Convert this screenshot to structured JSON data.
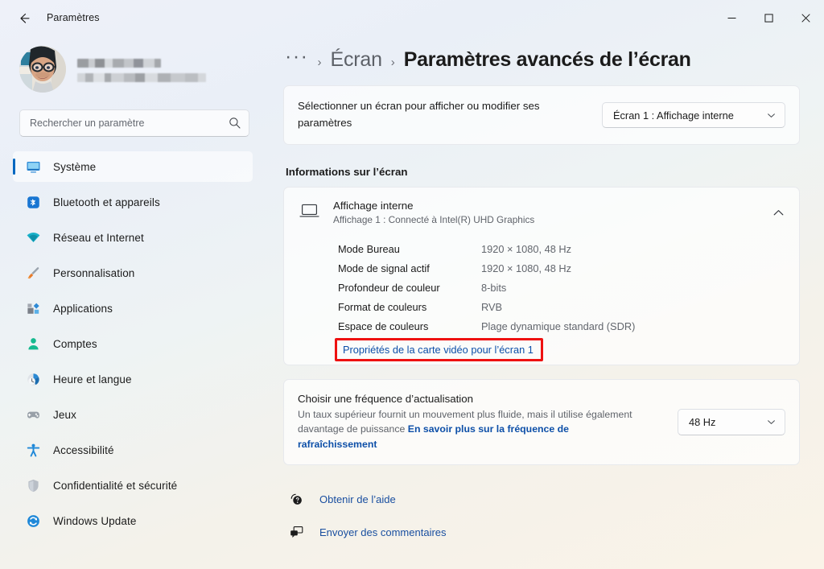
{
  "window": {
    "app_title": "Paramètres",
    "back_icon": "back-arrow-icon",
    "controls": {
      "minimize": "minimize-icon",
      "maximize": "maximize-icon",
      "close": "close-icon"
    }
  },
  "sidebar": {
    "profile": {
      "avatar": "user-avatar",
      "name_redacted": true,
      "email_redacted": true
    },
    "search": {
      "placeholder": "Rechercher un paramètre",
      "value": "",
      "icon": "search-icon"
    },
    "items": [
      {
        "label": "Système",
        "icon": "system-monitor-icon",
        "selected": true
      },
      {
        "label": "Bluetooth et appareils",
        "icon": "bluetooth-icon",
        "selected": false
      },
      {
        "label": "Réseau et Internet",
        "icon": "wifi-icon",
        "selected": false
      },
      {
        "label": "Personnalisation",
        "icon": "paintbrush-icon",
        "selected": false
      },
      {
        "label": "Applications",
        "icon": "apps-icon",
        "selected": false
      },
      {
        "label": "Comptes",
        "icon": "account-person-icon",
        "selected": false
      },
      {
        "label": "Heure et langue",
        "icon": "clock-icon",
        "selected": false
      },
      {
        "label": "Jeux",
        "icon": "gamepad-icon",
        "selected": false
      },
      {
        "label": "Accessibilité",
        "icon": "accessibility-person-icon",
        "selected": false
      },
      {
        "label": "Confidentialité et sécurité",
        "icon": "shield-icon",
        "selected": false
      },
      {
        "label": "Windows Update",
        "icon": "update-refresh-icon",
        "selected": false
      }
    ]
  },
  "breadcrumb": {
    "overflow": "···",
    "separator": "›",
    "parent": "Écran",
    "current": "Paramètres avancés de l’écran"
  },
  "select_display": {
    "description": "Sélectionner un écran pour afficher ou modifier ses paramètres",
    "dropdown_value": "Écran 1 : Affichage interne",
    "chevron_icon": "chevron-down-icon"
  },
  "display_info": {
    "section_title": "Informations sur l’écran",
    "monitor_icon": "laptop-display-icon",
    "title": "Affichage interne",
    "subtitle": "Affichage 1 : Connecté à Intel(R) UHD Graphics",
    "collapse_icon": "chevron-up-icon",
    "specs": [
      {
        "label": "Mode Bureau",
        "value": "1920 × 1080, 48 Hz"
      },
      {
        "label": "Mode de signal actif",
        "value": "1920 × 1080, 48 Hz"
      },
      {
        "label": "Profondeur de couleur",
        "value": "8-bits"
      },
      {
        "label": "Format de couleurs",
        "value": "RVB"
      },
      {
        "label": "Espace de couleurs",
        "value": "Plage dynamique standard (SDR)"
      }
    ],
    "adapter_link": "Propriétés de la carte vidéo pour l’écran 1",
    "adapter_link_highlighted": true
  },
  "refresh_rate": {
    "title": "Choisir une fréquence d’actualisation",
    "description": "Un taux supérieur fournit un mouvement plus fluide, mais il utilise également davantage de puissance",
    "learn_more": "En savoir plus sur la fréquence de rafraîchissement",
    "dropdown_value": "48 Hz",
    "chevron_icon": "chevron-down-icon"
  },
  "footer": {
    "links": [
      {
        "label": "Obtenir de l’aide",
        "icon": "help-question-icon"
      },
      {
        "label": "Envoyer des commentaires",
        "icon": "feedback-icon"
      }
    ]
  },
  "colors": {
    "accent": "#0067c0",
    "link": "#0d4fa8",
    "highlight_box": "#ee1111",
    "text_primary": "#1b1b1b",
    "text_secondary": "#5f636a"
  }
}
